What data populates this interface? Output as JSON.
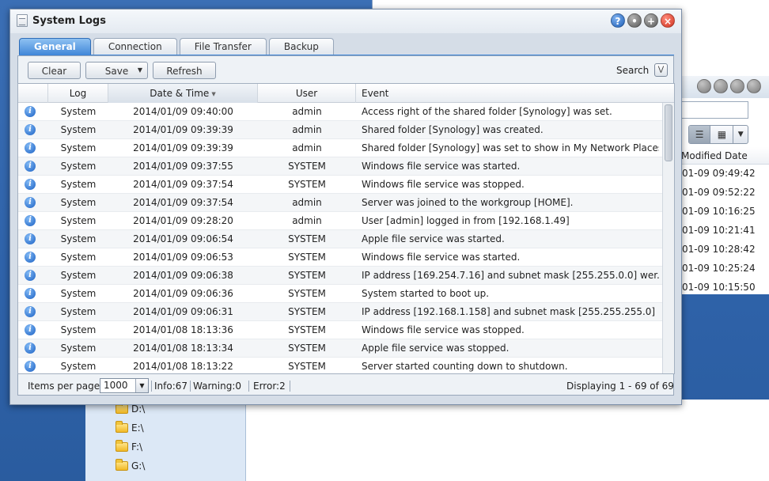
{
  "background": {
    "file_station": {
      "column_header": "Modified Date",
      "dates": [
        "01-09 09:49:42",
        "01-09 09:52:22",
        "01-09 10:16:25",
        "01-09 10:21:41",
        "01-09 10:28:42",
        "01-09 10:25:24",
        "01-09 10:15:50"
      ],
      "tree": [
        "D:\\",
        "E:\\",
        "F:\\",
        "G:\\"
      ],
      "view_icons": [
        "list-view-icon",
        "thumbnail-view-icon",
        "chevron-down-icon"
      ]
    }
  },
  "window": {
    "title": "System Logs",
    "title_buttons": [
      {
        "name": "help-icon",
        "glyph": "?"
      },
      {
        "name": "minimize-icon",
        "glyph": "•"
      },
      {
        "name": "maximize-icon",
        "glyph": "+"
      },
      {
        "name": "close-icon",
        "glyph": "×"
      }
    ]
  },
  "tabs": [
    {
      "label": "General",
      "active": true
    },
    {
      "label": "Connection",
      "active": false
    },
    {
      "label": "File Transfer",
      "active": false
    },
    {
      "label": "Backup",
      "active": false
    }
  ],
  "toolbar": {
    "clear_label": "Clear",
    "save_label": "Save",
    "refresh_label": "Refresh",
    "search_label": "Search"
  },
  "grid": {
    "columns": [
      "Log",
      "Date & Time",
      "User",
      "Event"
    ],
    "sorted_column": "Date & Time",
    "rows": [
      {
        "icon": "info-icon",
        "log": "System",
        "datetime": "2014/01/09 09:40:00",
        "user": "admin",
        "event": "Access right of the shared folder [Synology] was set."
      },
      {
        "icon": "info-icon",
        "log": "System",
        "datetime": "2014/01/09 09:39:39",
        "user": "admin",
        "event": "Shared folder [Synology] was created."
      },
      {
        "icon": "info-icon",
        "log": "System",
        "datetime": "2014/01/09 09:39:39",
        "user": "admin",
        "event": "Shared folder [Synology] was set to show in My Network Places."
      },
      {
        "icon": "info-icon",
        "log": "System",
        "datetime": "2014/01/09 09:37:55",
        "user": "SYSTEM",
        "event": "Windows file service was started."
      },
      {
        "icon": "info-icon",
        "log": "System",
        "datetime": "2014/01/09 09:37:54",
        "user": "SYSTEM",
        "event": "Windows file service was stopped."
      },
      {
        "icon": "info-icon",
        "log": "System",
        "datetime": "2014/01/09 09:37:54",
        "user": "admin",
        "event": "Server was joined to the workgroup [HOME]."
      },
      {
        "icon": "info-icon",
        "log": "System",
        "datetime": "2014/01/09 09:28:20",
        "user": "admin",
        "event": "User [admin] logged in from [192.168.1.49]"
      },
      {
        "icon": "info-icon",
        "log": "System",
        "datetime": "2014/01/09 09:06:54",
        "user": "SYSTEM",
        "event": "Apple file service was started."
      },
      {
        "icon": "info-icon",
        "log": "System",
        "datetime": "2014/01/09 09:06:53",
        "user": "SYSTEM",
        "event": "Windows file service was started."
      },
      {
        "icon": "info-icon",
        "log": "System",
        "datetime": "2014/01/09 09:06:38",
        "user": "SYSTEM",
        "event": "IP address [169.254.7.16] and subnet mask [255.255.0.0] wer..."
      },
      {
        "icon": "info-icon",
        "log": "System",
        "datetime": "2014/01/09 09:06:36",
        "user": "SYSTEM",
        "event": "System started to boot up."
      },
      {
        "icon": "info-icon",
        "log": "System",
        "datetime": "2014/01/09 09:06:31",
        "user": "SYSTEM",
        "event": "IP address [192.168.1.158] and subnet mask [255.255.255.0] ..."
      },
      {
        "icon": "info-icon",
        "log": "System",
        "datetime": "2014/01/08 18:13:36",
        "user": "SYSTEM",
        "event": "Windows file service was stopped."
      },
      {
        "icon": "info-icon",
        "log": "System",
        "datetime": "2014/01/08 18:13:34",
        "user": "SYSTEM",
        "event": "Apple file service was stopped."
      },
      {
        "icon": "info-icon",
        "log": "System",
        "datetime": "2014/01/08 18:13:22",
        "user": "SYSTEM",
        "event": "Server started counting down to shutdown."
      }
    ]
  },
  "footer": {
    "items_per_page_label": "Items per page",
    "items_per_page_value": "1000",
    "info": "Info:67",
    "warning": "Warning:0",
    "error": "Error:2",
    "displaying": "Displaying 1 - 69 of 69"
  },
  "colors": {
    "desktop": "#2f63aa",
    "tab_active": "#3f86d8",
    "info_icon": "#1d62c4",
    "close_button": "#d0321f"
  }
}
